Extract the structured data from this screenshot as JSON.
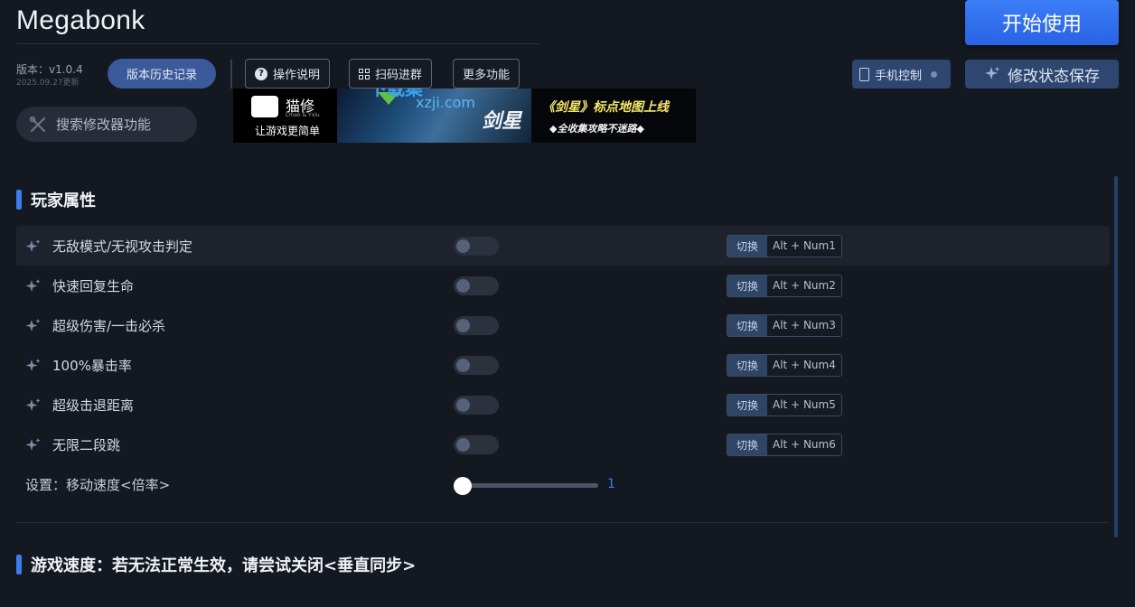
{
  "app": {
    "title": "Megabonk",
    "start_label": "开始使用",
    "version": "版本：v1.0.4",
    "version_date": "2025.09.27更新",
    "history_label": "版本历史记录",
    "guide_label": "操作说明",
    "qr_label": "扫码进群",
    "more_label": "更多功能",
    "phone_label": "手机控制",
    "save_label": "修改状态保存",
    "search_placeholder": "搜索修改器功能"
  },
  "banner": {
    "brand": "猫修",
    "brand_sub": "Lmao & Yxiu",
    "slogan": "让游戏更简单",
    "art_title": "剑星",
    "headline": "《剑星》标点地图上线",
    "tagline": "◆全收集攻略不迷路◆",
    "watermark": "下载集",
    "watermark_url": "xzji.com"
  },
  "sections": [
    {
      "title": "玩家属性",
      "toggles": [
        {
          "label": "无敌模式/无视攻击判定",
          "mode": "切换",
          "keys": "Alt + Num1",
          "on": false
        },
        {
          "label": "快速回复生命",
          "mode": "切换",
          "keys": "Alt + Num2",
          "on": false
        },
        {
          "label": "超级伤害/一击必杀",
          "mode": "切换",
          "keys": "Alt + Num3",
          "on": false
        },
        {
          "label": "100%暴击率",
          "mode": "切换",
          "keys": "Alt + Num4",
          "on": false
        },
        {
          "label": "超级击退距离",
          "mode": "切换",
          "keys": "Alt + Num5",
          "on": false
        },
        {
          "label": "无限二段跳",
          "mode": "切换",
          "keys": "Alt + Num6",
          "on": false
        }
      ],
      "setting": {
        "label": "设置：移动速度<倍率>",
        "value": "1"
      }
    },
    {
      "title": "游戏速度：若无法正常生效，请尝试关闭<垂直同步>"
    }
  ]
}
